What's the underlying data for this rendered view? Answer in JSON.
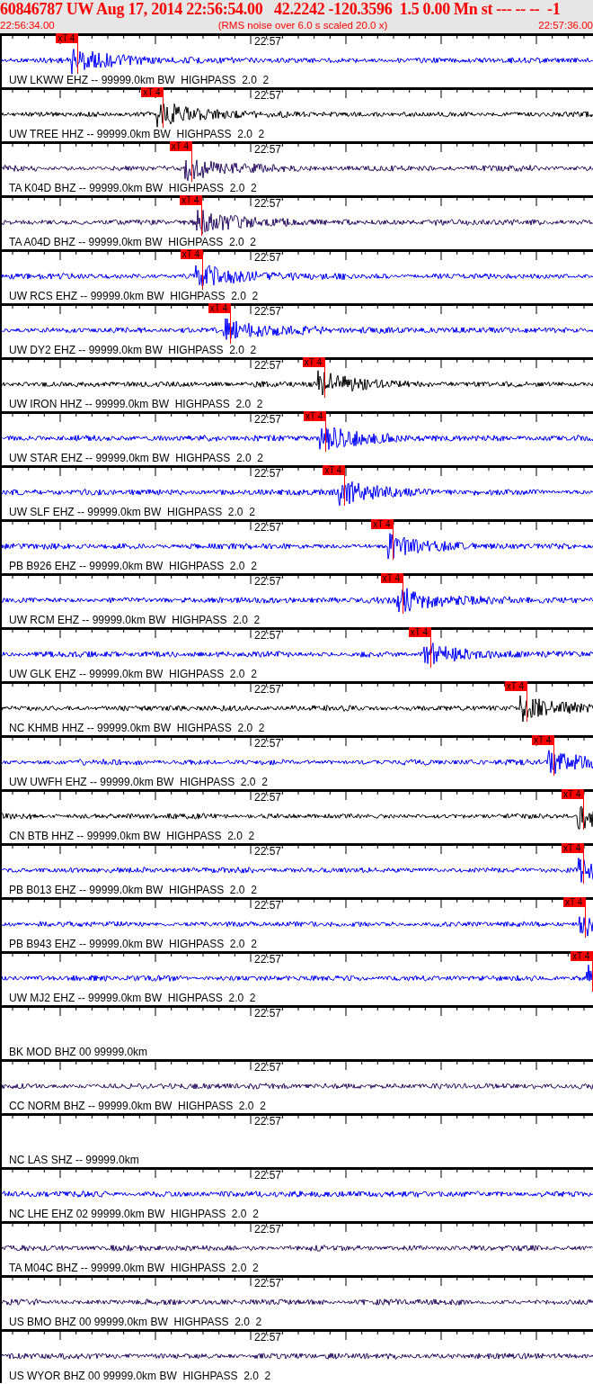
{
  "header": {
    "event": "60846787 UW Aug 17, 2014 22:56:54.00   42.2242 -120.3596  1.5 0.00 Mn st --- -- --  -1",
    "start_time": "22:56:34.00",
    "note": "(RMS noise over 6.0 s scaled 20.0 x)",
    "end_time": "22:57:36.00"
  },
  "traces": [
    {
      "kind": "trace",
      "label": "UW LKWW EHZ -- 99999.0km BW  HIGHPASS  2.0  2",
      "time_label": "22:57",
      "color": "#0000ff",
      "pick": {
        "label": "xT 4",
        "level": 0.129
      }
    },
    {
      "kind": "trace",
      "label": "UW TREE HHZ -- 99999.0km BW  HIGHPASS  2.0  2",
      "time_label": "22:57",
      "color": "#000000",
      "pick": {
        "label": "xT 4",
        "level": 0.273
      }
    },
    {
      "kind": "trace",
      "label": "TA K04D BHZ -- 99999.0km BW  HIGHPASS  2.0  2",
      "time_label": "22:57",
      "color": "#2b0f63",
      "pick": {
        "label": "xT 4",
        "level": 0.321
      }
    },
    {
      "kind": "trace",
      "label": "TA A04D BHZ -- 99999.0km BW  HIGHPASS  2.0  2",
      "time_label": "22:57",
      "color": "#2b0f63",
      "pick": {
        "label": "xT 4",
        "level": 0.338
      }
    },
    {
      "kind": "trace",
      "label": "UW RCS EHZ -- 99999.0km BW  HIGHPASS  2.0  2",
      "time_label": "22:57",
      "color": "#0000ff",
      "pick": {
        "label": "xT 4",
        "level": 0.339
      }
    },
    {
      "kind": "trace",
      "label": "UW DY2 EHZ -- 99999.0km BW  HIGHPASS  2.0  2",
      "time_label": "22:57",
      "color": "#0000ff",
      "pick": {
        "label": "xT 4",
        "level": 0.386
      }
    },
    {
      "kind": "trace",
      "label": "UW IRON HHZ -- 99999.0km BW  HIGHPASS  2.0  2",
      "time_label": "22:57",
      "color": "#000000",
      "pick": {
        "label": "xT 4",
        "level": 0.545
      }
    },
    {
      "kind": "trace",
      "label": "UW STAR EHZ -- 99999.0km BW  HIGHPASS  2.0  2",
      "time_label": "22:57",
      "color": "#0000ff",
      "pick": {
        "label": "xT 4",
        "level": 0.547
      }
    },
    {
      "kind": "trace",
      "label": "UW SLF EHZ -- 99999.0km BW  HIGHPASS  2.0  2",
      "time_label": "22:57",
      "color": "#0000ff",
      "pick": {
        "label": "xT 4",
        "level": 0.579
      }
    },
    {
      "kind": "trace",
      "label": "PB B926 EHZ -- 99999.0km BW  HIGHPASS  2.0  2",
      "time_label": "22:57",
      "color": "#0000ff",
      "pick": {
        "label": "xT 4",
        "level": 0.661
      }
    },
    {
      "kind": "trace",
      "label": "UW RCM EHZ -- 99999.0km BW  HIGHPASS  2.0  2",
      "time_label": "22:57",
      "color": "#0000ff",
      "pick": {
        "label": "xT 4",
        "level": 0.677
      }
    },
    {
      "kind": "trace",
      "label": "UW GLK EHZ -- 99999.0km BW  HIGHPASS  2.0  2",
      "time_label": "22:57",
      "color": "#0000ff",
      "pick": {
        "label": "xT 4",
        "level": 0.724
      }
    },
    {
      "kind": "trace",
      "label": "NC KHMB HHZ -- 99999.0km BW  HIGHPASS  2.0  2",
      "time_label": "22:57",
      "color": "#000000",
      "pick": {
        "label": "xT 4",
        "level": 0.886
      }
    },
    {
      "kind": "trace",
      "label": "UW UWFH EHZ -- 99999.0km BW  HIGHPASS  2.0  2",
      "time_label": "22:57",
      "color": "#0000ff",
      "pick": {
        "label": "xT 4",
        "level": 0.932
      }
    },
    {
      "kind": "trace",
      "label": "CN BTB HHZ -- 99999.0km BW  HIGHPASS  2.0  2",
      "time_label": "22:57",
      "color": "#000000",
      "pick": {
        "label": "xT 4",
        "level": 0.982
      }
    },
    {
      "kind": "trace",
      "label": "PB B013 EHZ -- 99999.0km BW  HIGHPASS  2.0  2",
      "time_label": "22:57",
      "color": "#0000ff",
      "pick": {
        "label": "xT 4",
        "level": 0.982
      }
    },
    {
      "kind": "trace",
      "label": "PB B943 EHZ -- 99999.0km BW  HIGHPASS  2.0  2",
      "time_label": "22:57",
      "color": "#0000ff",
      "pick": {
        "label": "xT 4",
        "level": 0.985
      }
    },
    {
      "kind": "trace",
      "label": "UW MJ2 EHZ -- 99999.0km BW  HIGHPASS  2.0  2",
      "time_label": "22:57",
      "color": "#0000ff",
      "pick": {
        "label": "xT 4",
        "level": 0.997
      }
    },
    {
      "kind": "blank",
      "label": "BK MOD BHZ 00 99999.0km",
      "time_label": "22:57",
      "color": "#000000"
    },
    {
      "kind": "trace",
      "label": "CC NORM BHZ -- 99999.0km BW  HIGHPASS  2.0  2",
      "time_label": "22:57",
      "color": "#2b0f63"
    },
    {
      "kind": "blank",
      "label": "NC LAS SHZ -- 99999.0km",
      "time_label": "22:57",
      "color": "#000000"
    },
    {
      "kind": "trace",
      "label": "NC LHE EHZ 02 99999.0km BW  HIGHPASS  2.0  2",
      "time_label": "22:57",
      "color": "#0000ff"
    },
    {
      "kind": "trace",
      "label": "TA M04C BHZ -- 99999.0km BW  HIGHPASS  2.0  2",
      "time_label": "22:57",
      "color": "#2b0f63"
    },
    {
      "kind": "trace",
      "label": "US BMO BHZ 00 99999.0km BW  HIGHPASS  2.0  2",
      "time_label": "22:57",
      "color": "#2b0f63"
    },
    {
      "kind": "trace",
      "label": "US WYOR BHZ 00 99999.0km BW  HIGHPASS  2.0  2",
      "time_label": "22:57",
      "color": "#2b0f63"
    }
  ]
}
